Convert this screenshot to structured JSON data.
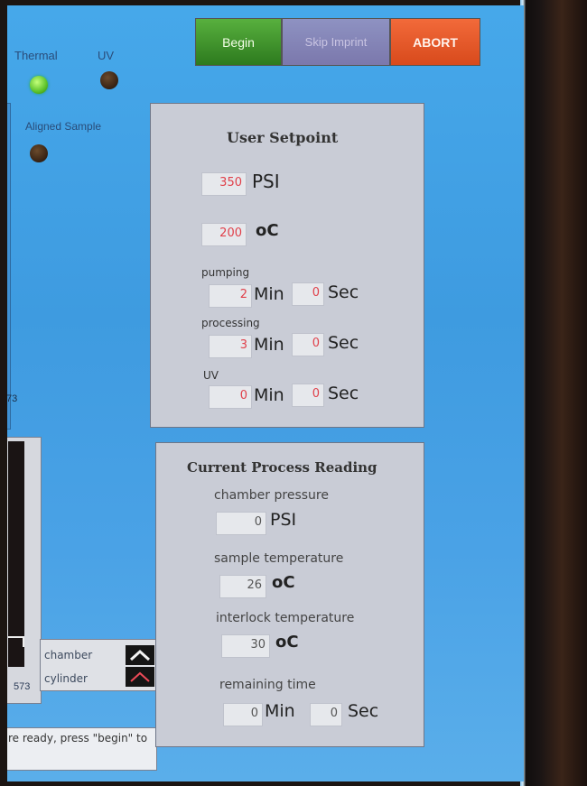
{
  "indicators": {
    "thermal_label": "Thermal",
    "uv_label": "UV",
    "aligned_label": "Aligned Sample"
  },
  "toolbar": {
    "begin_label": "Begin",
    "skip_label": "Skip Imprint",
    "abort_label": "ABORT"
  },
  "setpoint": {
    "title": "User Setpoint",
    "pressure_value": "350",
    "pressure_unit": "PSI",
    "temp_value": "200",
    "temp_unit": "oC",
    "pumping_label": "pumping",
    "pumping_min": "2",
    "pumping_sec": "0",
    "processing_label": "processing",
    "processing_min": "3",
    "processing_sec": "0",
    "uv_label": "UV",
    "uv_min": "0",
    "uv_sec": "0",
    "min_unit": "Min",
    "sec_unit": "Sec"
  },
  "reading": {
    "title": "Current Process Reading",
    "chamber_pressure_label": "chamber pressure",
    "chamber_pressure_value": "0",
    "chamber_pressure_unit": "PSI",
    "sample_temp_label": "sample temperature",
    "sample_temp_value": "26",
    "sample_temp_unit": "oC",
    "interlock_temp_label": "interlock temperature",
    "interlock_temp_value": "30",
    "interlock_temp_unit": "oC",
    "remaining_label": "remaining time",
    "remaining_min": "0",
    "remaining_sec": "0",
    "min_unit": "Min",
    "sec_unit": "Sec"
  },
  "left": {
    "tick_73_upper": "73",
    "tick_573": "573",
    "legend_chamber": "chamber",
    "legend_cylinder": "cylinder",
    "status_text": "re ready, press \"begin\" to"
  }
}
